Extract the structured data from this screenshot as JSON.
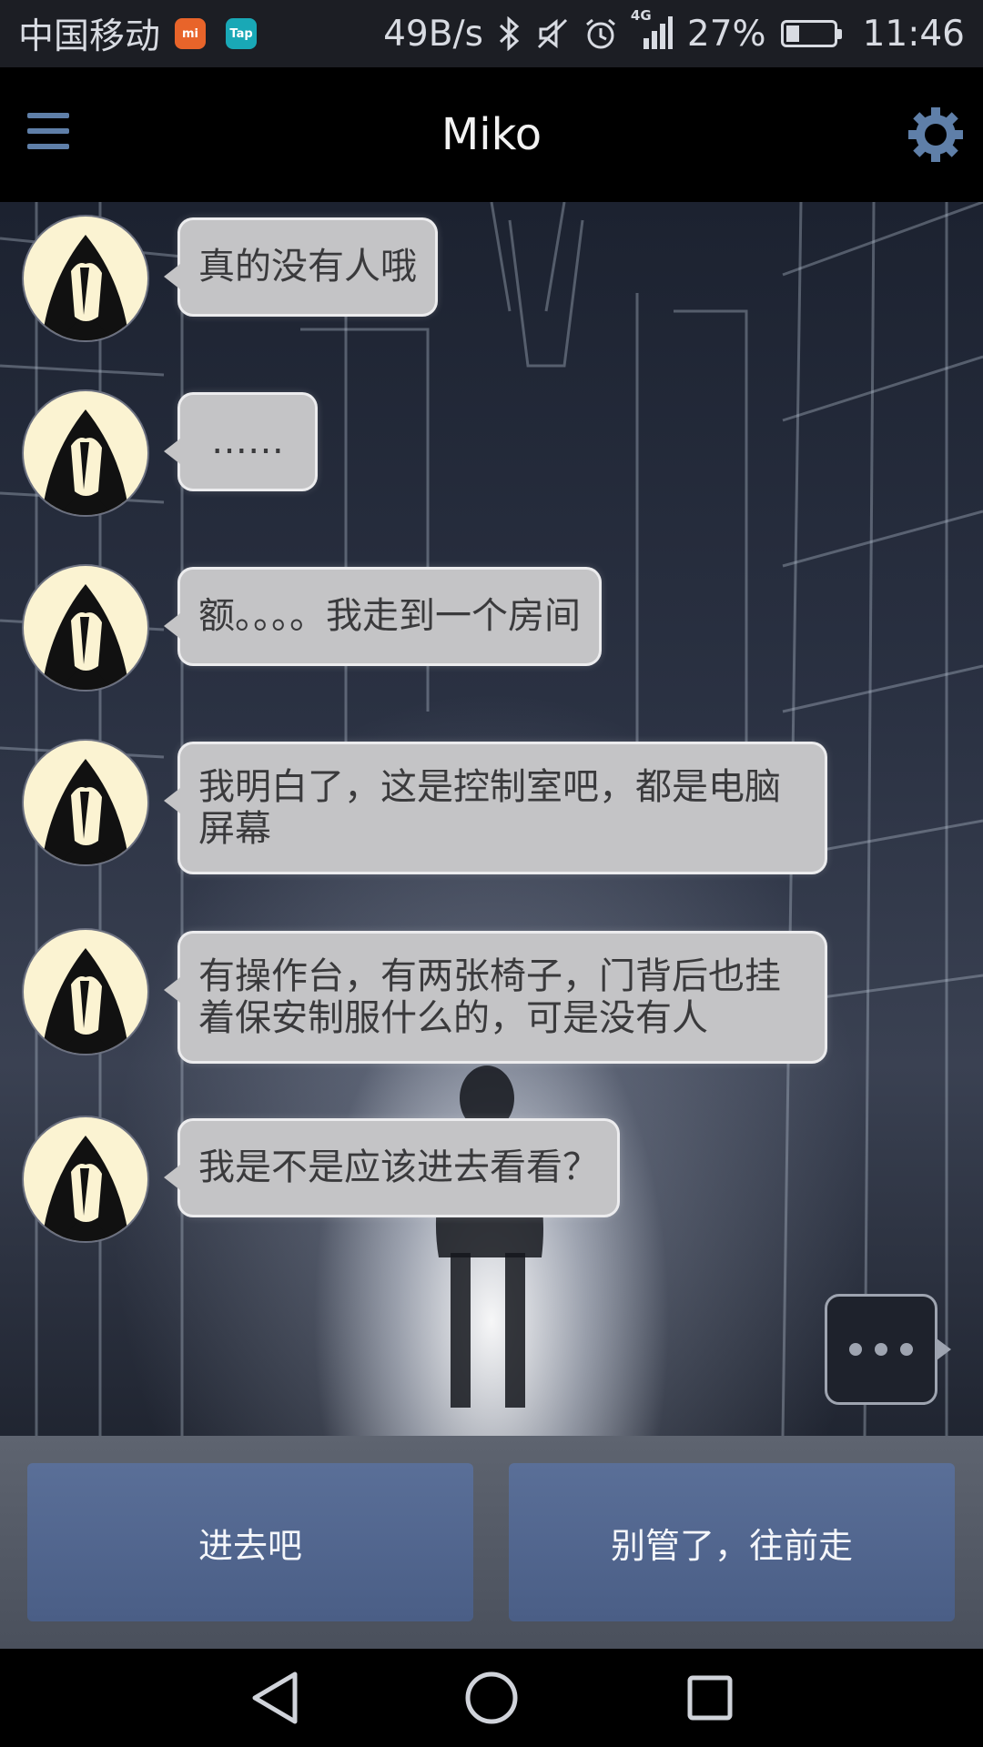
{
  "status_bar": {
    "carrier": "中国移动",
    "app_icons": [
      {
        "name": "mi-icon",
        "label": "mi",
        "color": "#e8642a"
      },
      {
        "name": "tap-icon",
        "label": "Tap",
        "color": "#19a8b6"
      }
    ],
    "net_speed": "49B/s",
    "network_type": "4G",
    "battery_percent": "27%",
    "battery_level": 0.27,
    "time": "11:46"
  },
  "app_bar": {
    "title": "Miko",
    "menu_icon": "hamburger-menu-icon",
    "settings_icon": "gear-icon",
    "accent_color": "#5f7fa8"
  },
  "messages": [
    {
      "sender": "miko",
      "text": "真的没有人哦"
    },
    {
      "sender": "miko",
      "text": "……"
    },
    {
      "sender": "miko",
      "text": "额。。。。我走到一个房间"
    },
    {
      "sender": "miko",
      "text": "我明白了，这是控制室吧，都是电脑屏幕"
    },
    {
      "sender": "miko",
      "text": "有操作台，有两张椅子，门背后也挂着保安制服什么的，可是没有人"
    },
    {
      "sender": "miko",
      "text": "我是不是应该进去看看？"
    }
  ],
  "typing_indicator": "typing-dots-icon",
  "choices": [
    {
      "label": "进去吧"
    },
    {
      "label": "别管了，往前走"
    }
  ],
  "nav_bar": {
    "back_icon": "back-triangle-icon",
    "home_icon": "home-circle-icon",
    "recents_icon": "recents-square-icon"
  }
}
